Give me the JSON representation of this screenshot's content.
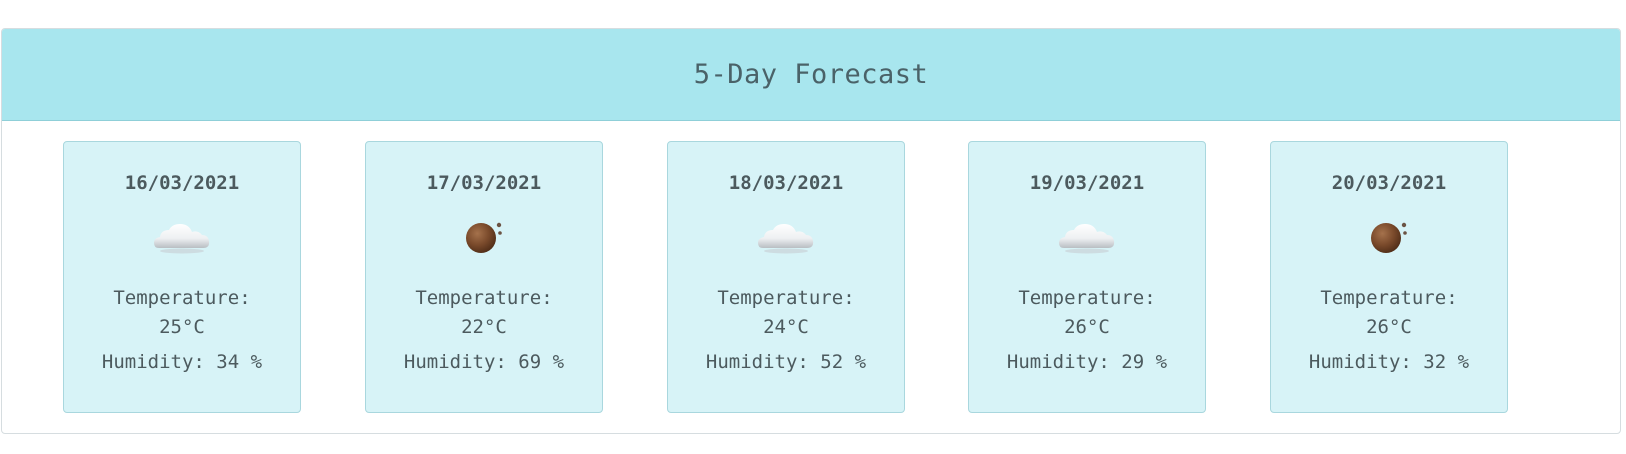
{
  "header": {
    "title": "5-Day Forecast"
  },
  "colors": {
    "header_bg": "#a8e6ee",
    "card_bg": "#d7f3f7",
    "text": "#4c5a5e"
  },
  "forecast": [
    {
      "date": "16/03/2021",
      "icon": "cloud-icon",
      "temp_label": "Temperature:",
      "temp_value": "25°C",
      "humidity": "Humidity: 34 %"
    },
    {
      "date": "17/03/2021",
      "icon": "moon-icon",
      "temp_label": "Temperature:",
      "temp_value": "22°C",
      "humidity": "Humidity: 69 %"
    },
    {
      "date": "18/03/2021",
      "icon": "cloud-icon",
      "temp_label": "Temperature:",
      "temp_value": "24°C",
      "humidity": "Humidity: 52 %"
    },
    {
      "date": "19/03/2021",
      "icon": "cloud-icon",
      "temp_label": "Temperature:",
      "temp_value": "26°C",
      "humidity": "Humidity: 29 %"
    },
    {
      "date": "20/03/2021",
      "icon": "moon-icon",
      "temp_label": "Temperature:",
      "temp_value": "26°C",
      "humidity": "Humidity: 32 %"
    }
  ]
}
